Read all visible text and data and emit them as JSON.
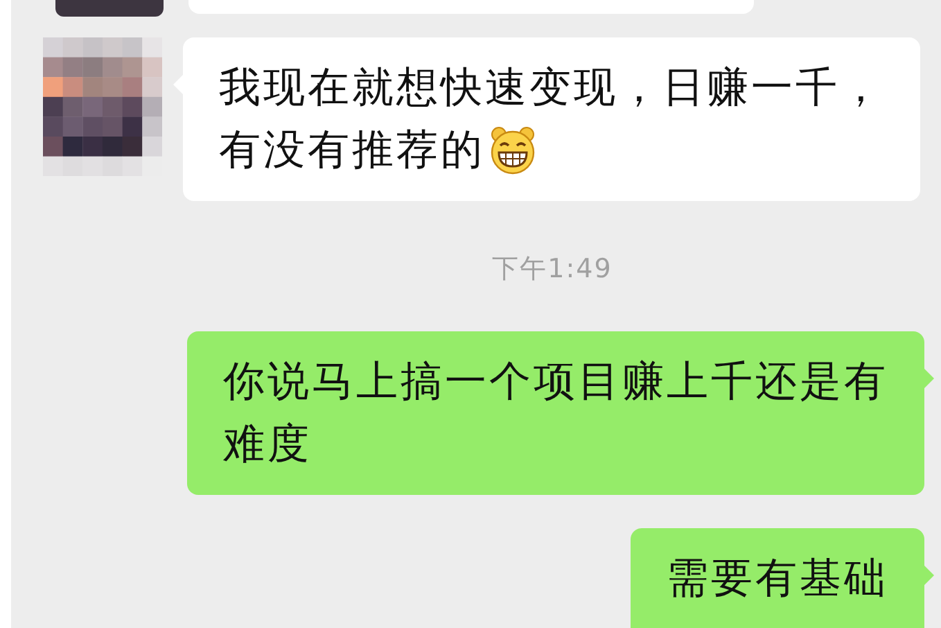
{
  "messages": [
    {
      "kind": "received",
      "cut": true
    },
    {
      "kind": "received",
      "cut": false,
      "lines": [
        "我现在就想快速变现，日赚一千，",
        "有没有推荐的"
      ],
      "emoji": true
    },
    {
      "kind": "time",
      "text": "下午1:49"
    },
    {
      "kind": "sent",
      "cut": false,
      "lines": [
        "你说马上搞一个项目赚上千还是有",
        "难度"
      ]
    },
    {
      "kind": "sent",
      "cut": true,
      "lines": [
        "需要有基础"
      ]
    }
  ]
}
